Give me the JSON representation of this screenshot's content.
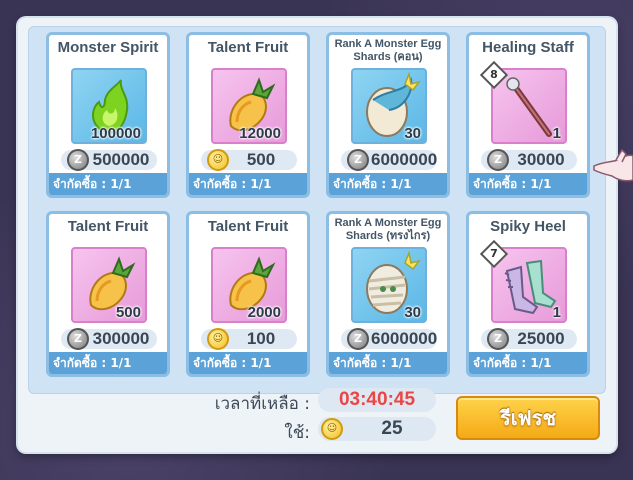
{
  "items": [
    {
      "name": "Monster Spirit",
      "qty": "100000",
      "price": "500000",
      "currency": "zeny",
      "limit": "จำกัดซื้อ : 1/1",
      "bg": "blue",
      "icon": "green-flame-icon"
    },
    {
      "name": "Talent Fruit",
      "qty": "12000",
      "price": "500",
      "currency": "gold-coin",
      "limit": "จำกัดซื้อ : 1/1",
      "bg": "pink",
      "icon": "talent-fruit-icon"
    },
    {
      "name": "Rank A Monster Egg Shards (คอน)",
      "qty": "30",
      "price": "6000000",
      "currency": "zeny",
      "limit": "จำกัดซื้อ : 1/1",
      "bg": "blue",
      "icon": "monster-egg-shard-icon"
    },
    {
      "name": "Healing Staff",
      "qty": "1",
      "price": "30000",
      "currency": "zeny",
      "limit": "จำกัดซื้อ : 1/1",
      "bg": "pink",
      "icon": "staff-icon",
      "level": "8"
    },
    {
      "name": "Talent Fruit",
      "qty": "500",
      "price": "300000",
      "currency": "zeny",
      "limit": "จำกัดซื้อ : 1/1",
      "bg": "pink",
      "icon": "talent-fruit-icon"
    },
    {
      "name": "Talent Fruit",
      "qty": "2000",
      "price": "100",
      "currency": "gold-coin",
      "limit": "จำกัดซื้อ : 1/1",
      "bg": "pink",
      "icon": "talent-fruit-icon"
    },
    {
      "name": "Rank A Monster Egg Shards (ทรงไกร)",
      "qty": "30",
      "price": "6000000",
      "currency": "zeny",
      "limit": "จำกัดซื้อ : 1/1",
      "bg": "blue",
      "icon": "mummy-egg-shard-icon"
    },
    {
      "name": "Spiky Heel",
      "qty": "1",
      "price": "25000",
      "currency": "zeny",
      "limit": "จำกัดซื้อ : 1/1",
      "bg": "pink",
      "icon": "spiky-heel-icon",
      "level": "7"
    }
  ],
  "footer": {
    "time_label": "เวลาที่เหลือ :",
    "time_value": "03:40:45",
    "cost_label": "ใช้:",
    "cost_value": "25",
    "refresh_label": "รีเฟรช"
  },
  "coin_glyphs": {
    "zeny": "Z",
    "gold": "☺"
  },
  "colors": {
    "timer": "#ea4646",
    "refresh_button": "#f5a916",
    "limit_bar": "#5aa2d8",
    "card_border": "#8cbde3"
  }
}
